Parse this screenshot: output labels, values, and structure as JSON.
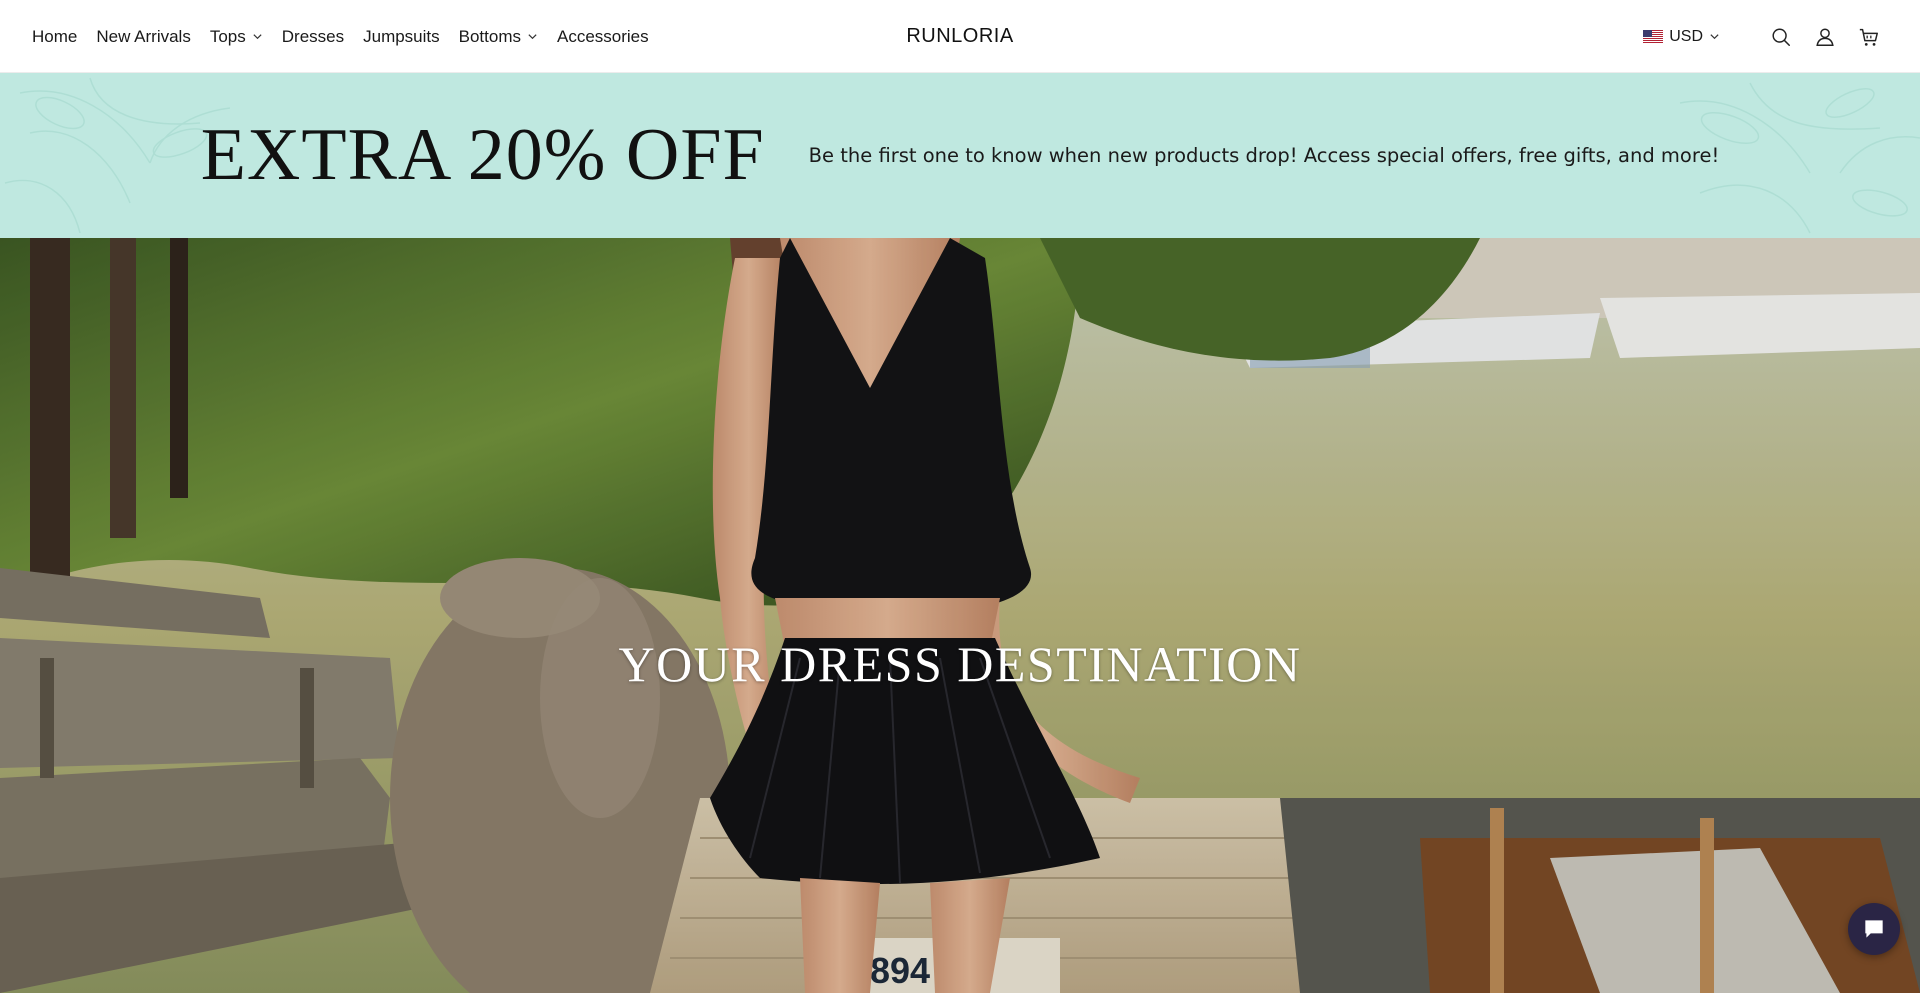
{
  "header": {
    "nav": [
      {
        "label": "Home",
        "has_dropdown": false
      },
      {
        "label": "New Arrivals",
        "has_dropdown": false
      },
      {
        "label": "Tops",
        "has_dropdown": true
      },
      {
        "label": "Dresses",
        "has_dropdown": false
      },
      {
        "label": "Jumpsuits",
        "has_dropdown": false
      },
      {
        "label": "Bottoms",
        "has_dropdown": true
      },
      {
        "label": "Accessories",
        "has_dropdown": false
      }
    ],
    "brand": "RUNLORIA",
    "currency": {
      "code": "USD",
      "flag": "us-flag-icon"
    },
    "icons": [
      "search-icon",
      "account-icon",
      "cart-icon"
    ]
  },
  "promo": {
    "title": "EXTRA 20% OFF",
    "subtitle": "Be the first one to know when new products drop! Access special offers, free gifts, and more!",
    "background": "#bfe8e0"
  },
  "hero": {
    "title": "YOUR DRESS DESTINATION"
  },
  "chat": {
    "icon": "chat-icon",
    "color": "#2a2545"
  }
}
